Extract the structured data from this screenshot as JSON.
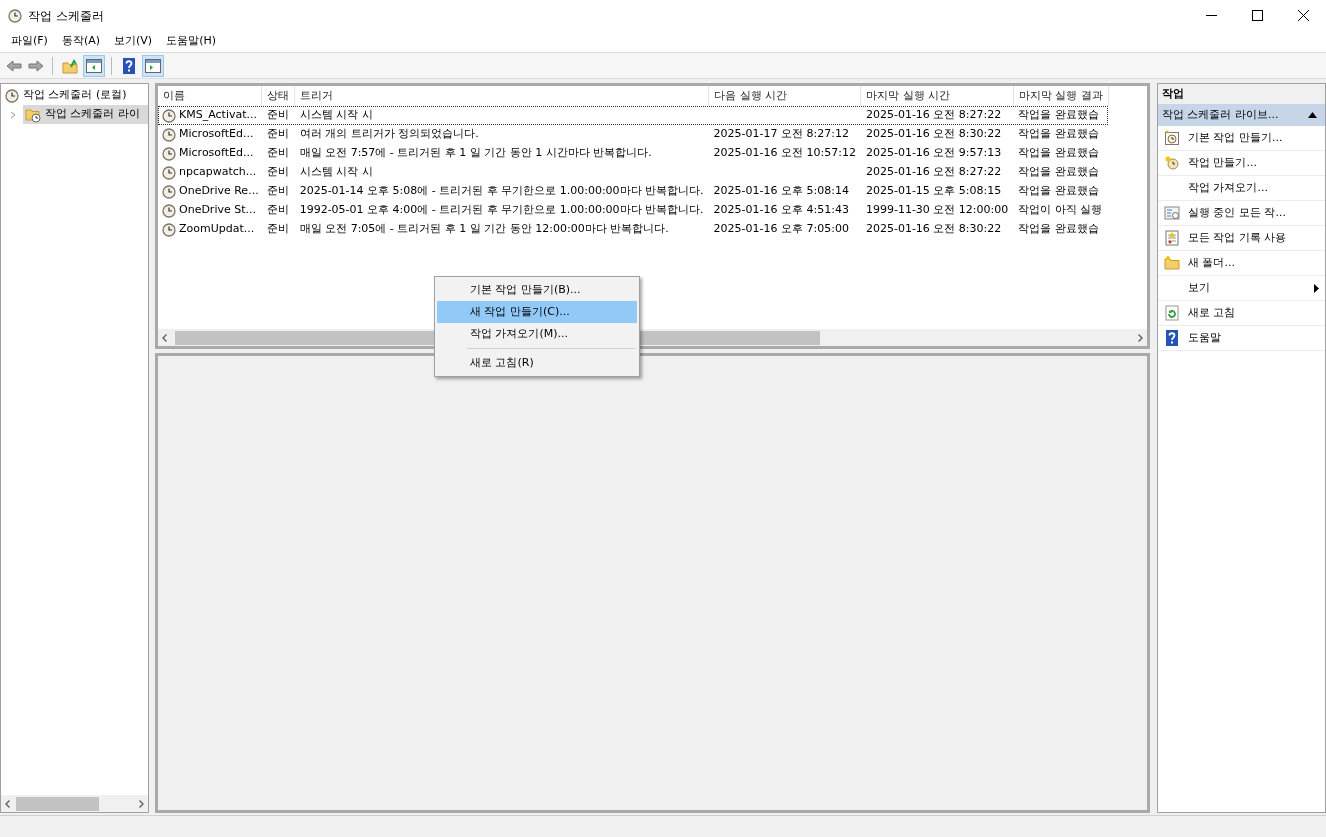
{
  "window": {
    "title": "작업 스케줄러"
  },
  "menu": [
    "파일(F)",
    "동작(A)",
    "보기(V)",
    "도움말(H)"
  ],
  "tree": [
    {
      "label": "작업 스케줄러 (로컬)",
      "selected": false,
      "children": [
        {
          "label": "작업 스케줄러 라이",
          "selected": true,
          "expanded": false
        }
      ]
    }
  ],
  "table": {
    "columns": [
      "이름",
      "상태",
      "트리거",
      "다음 실행 시간",
      "마지막 실행 시간",
      "마지막 실행 결과"
    ],
    "rows": [
      {
        "cells": [
          "KMS_Activat...",
          "준비",
          "시스템 시작 시",
          "",
          "2025-01-16 오전 8:27:22",
          "작업을 완료했습"
        ],
        "focused": true
      },
      {
        "cells": [
          "MicrosoftEd...",
          "준비",
          "여러 개의 트리거가 정의되었습니다.",
          "2025-01-17 오전 8:27:12",
          "2025-01-16 오전 8:30:22",
          "작업을 완료했습"
        ],
        "focused": false
      },
      {
        "cells": [
          "MicrosoftEd...",
          "준비",
          "매일 오전 7:57에 - 트리거된 후 1 일 기간 동안 1 시간마다 반복합니다.",
          "2025-01-16 오전 10:57:12",
          "2025-01-16 오전 9:57:13",
          "작업을 완료했습"
        ],
        "focused": false
      },
      {
        "cells": [
          "npcapwatch...",
          "준비",
          "시스템 시작 시",
          "",
          "2025-01-16 오전 8:27:22",
          "작업을 완료했습"
        ],
        "focused": false
      },
      {
        "cells": [
          "OneDrive Re...",
          "준비",
          "2025-01-14 오후 5:08에 - 트리거된 후 무기한으로 1.00:00:00마다 반복합니다.",
          "2025-01-16 오후 5:08:14",
          "2025-01-15 오후 5:08:15",
          "작업을 완료했습"
        ],
        "focused": false
      },
      {
        "cells": [
          "OneDrive St...",
          "준비",
          "1992-05-01 오후 4:00에 - 트리거된 후 무기한으로 1.00:00:00마다 반복합니다.",
          "2025-01-16 오후 4:51:43",
          "1999-11-30 오전 12:00:00",
          "작업이 아직 실행"
        ],
        "focused": false
      },
      {
        "cells": [
          "ZoomUpdat...",
          "준비",
          "매일 오전 7:05에 - 트리거된 후 1 일 기간 동안 12:00:00마다 반복합니다.",
          "2025-01-16 오후 7:05:00",
          "2025-01-16 오전 8:30:22",
          "작업을 완료했습"
        ],
        "focused": false
      }
    ]
  },
  "context_menu": [
    {
      "kind": "item",
      "label": "기본 작업 만들기(B)...",
      "selected": false
    },
    {
      "kind": "item",
      "label": "새 작업 만들기(C)...",
      "selected": true
    },
    {
      "kind": "item",
      "label": "작업 가져오기(M)...",
      "selected": false
    },
    {
      "kind": "separator"
    },
    {
      "kind": "item",
      "label": "새로 고침(R)",
      "selected": false
    }
  ],
  "actions": {
    "header": "작업",
    "group": {
      "title": "작업 스케줄러 라이브...",
      "expanded": true
    },
    "items": [
      {
        "label": "기본 작업 만들기...",
        "submenu": false
      },
      {
        "label": "작업 만들기...",
        "submenu": false
      },
      {
        "label": "작업 가져오기...",
        "submenu": false
      },
      {
        "label": "실행 중인 모든 작...",
        "submenu": false
      },
      {
        "label": "모든 작업 기록 사용",
        "submenu": false
      },
      {
        "label": "새 폴더...",
        "submenu": false
      },
      {
        "label": "보기",
        "submenu": true
      },
      {
        "label": "새로 고침",
        "submenu": false
      },
      {
        "label": "도움말",
        "submenu": false
      }
    ]
  }
}
